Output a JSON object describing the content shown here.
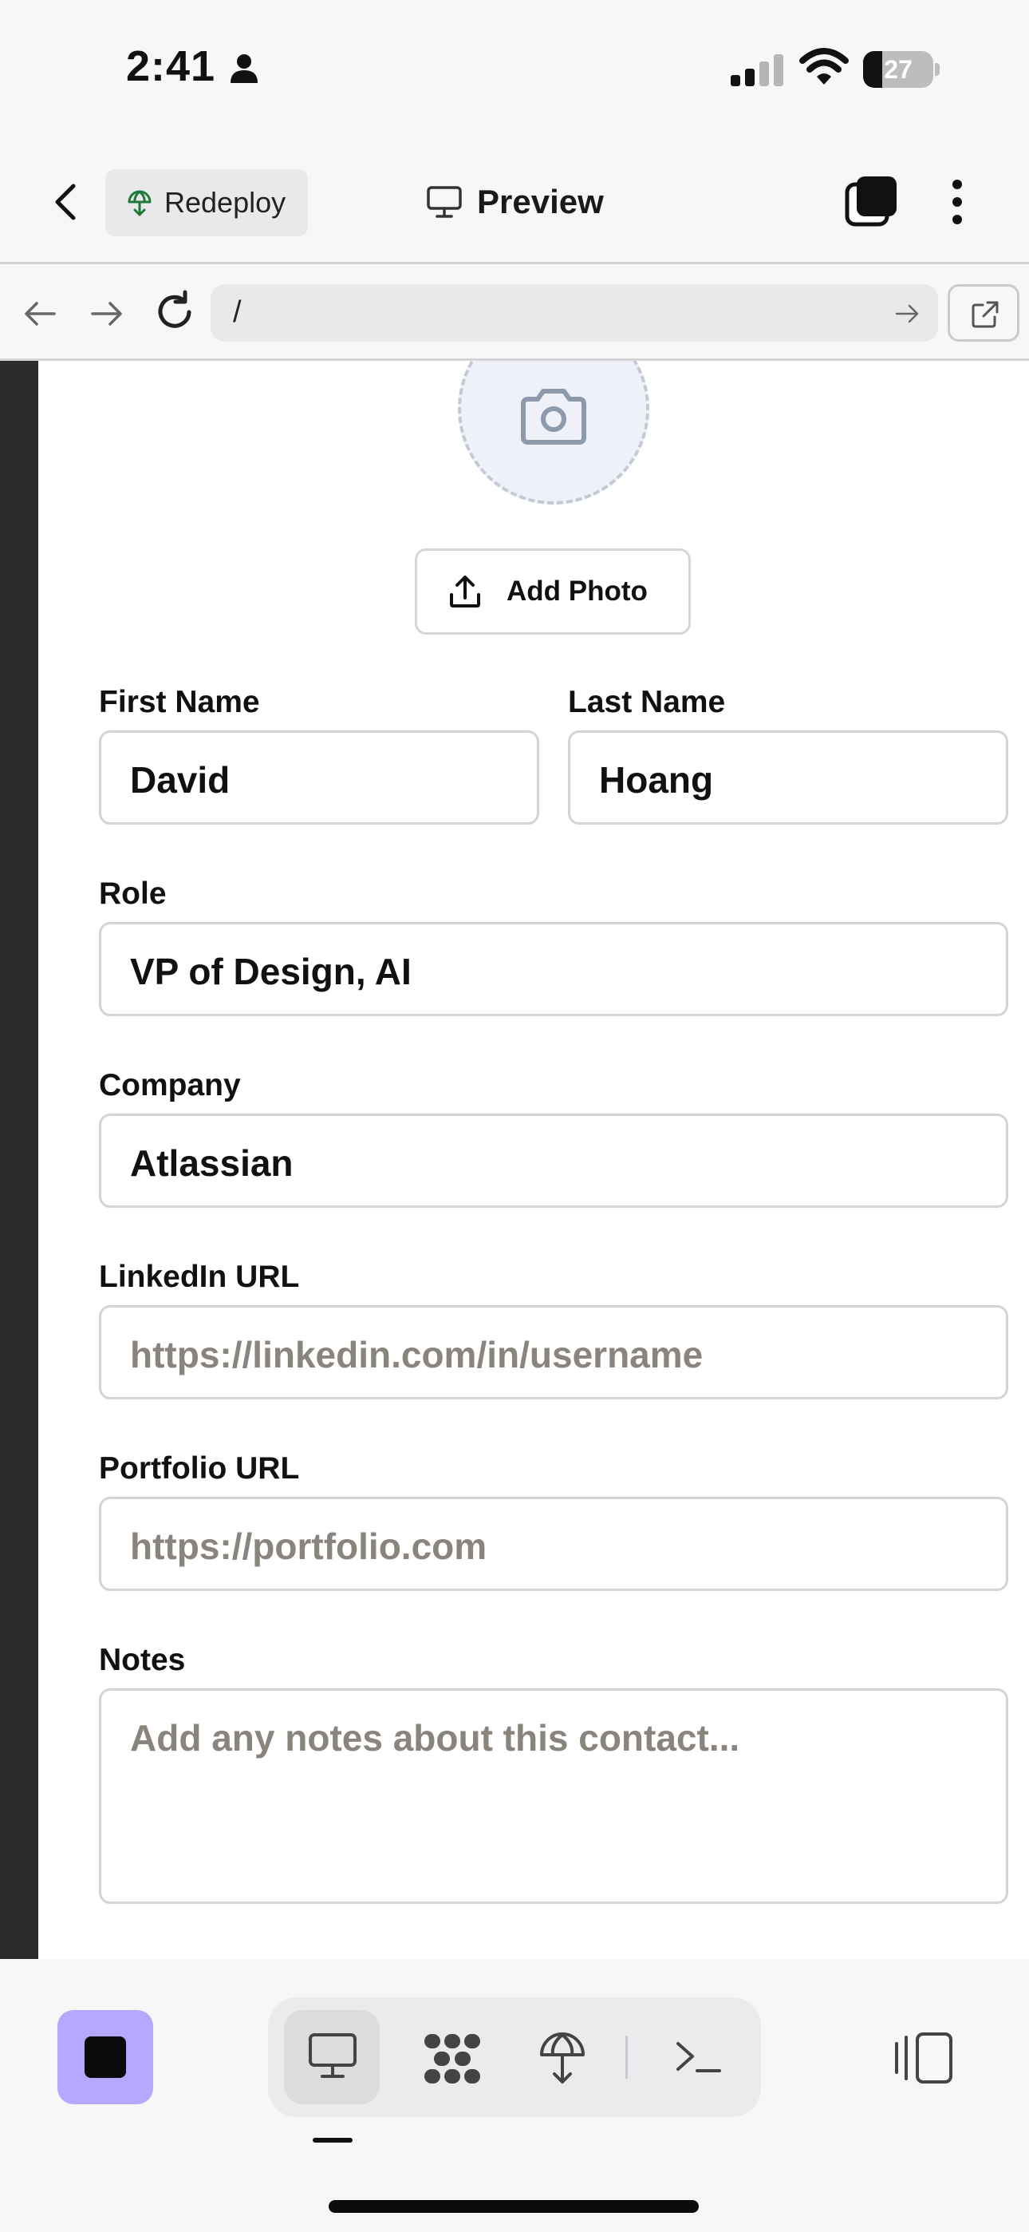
{
  "status_bar": {
    "time": "2:41",
    "battery_percent": "27",
    "battery_level": 0.27
  },
  "app_bar": {
    "redeploy_label": "Redeploy",
    "title": "Preview"
  },
  "url_bar": {
    "path": "/"
  },
  "form": {
    "add_photo_label": "Add Photo",
    "first_name": {
      "label": "First Name",
      "value": "David"
    },
    "last_name": {
      "label": "Last Name",
      "value": "Hoang"
    },
    "role": {
      "label": "Role",
      "value": "VP of Design, AI"
    },
    "company": {
      "label": "Company",
      "value": "Atlassian"
    },
    "linkedin": {
      "label": "LinkedIn URL",
      "placeholder": "https://linkedin.com/in/username"
    },
    "portfolio": {
      "label": "Portfolio URL",
      "placeholder": "https://portfolio.com"
    },
    "notes": {
      "label": "Notes",
      "placeholder": "Add any notes about this contact..."
    }
  },
  "bottom_bar": {
    "stop_color": "#b5a8ff",
    "segments": [
      "monitor-icon",
      "blocks-icon",
      "deploy-icon",
      "terminal-icon"
    ],
    "active_segment": "monitor-icon"
  },
  "icons": {
    "back": "chevron-left-icon",
    "redeploy": "deploy-icon",
    "preview": "monitor-icon",
    "tabs": "tabs-icon",
    "more": "more-vertical-icon",
    "camera": "camera-icon",
    "upload": "upload-icon",
    "open_external": "external-link-icon",
    "panel": "panel-toggle-icon"
  }
}
